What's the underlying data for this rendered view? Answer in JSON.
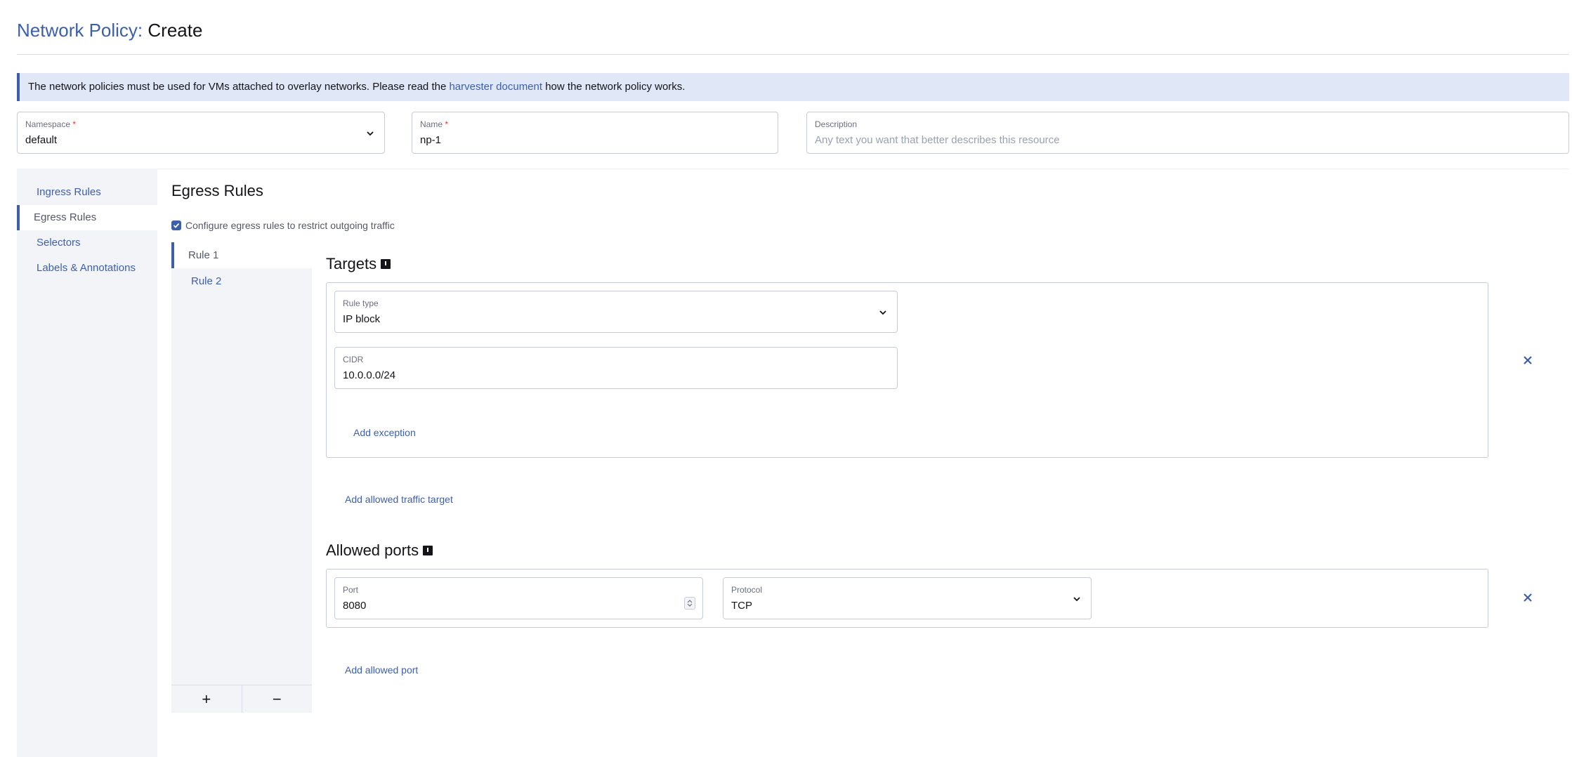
{
  "page": {
    "title_prefix": "Network Policy:",
    "title_mode": "Create"
  },
  "banner": {
    "text_before": "The network policies must be used for VMs attached to overlay networks. Please read the ",
    "link_text": "harvester document",
    "text_after": " how the network policy works."
  },
  "form": {
    "namespace": {
      "label": "Namespace",
      "required_mark": "*",
      "value": "default"
    },
    "name": {
      "label": "Name",
      "required_mark": "*",
      "value": "np-1"
    },
    "description": {
      "label": "Description",
      "placeholder": "Any text you want that better describes this resource"
    }
  },
  "sidebar": {
    "items": [
      {
        "label": "Ingress Rules",
        "active": false
      },
      {
        "label": "Egress Rules",
        "active": true
      },
      {
        "label": "Selectors",
        "active": false
      },
      {
        "label": "Labels & Annotations",
        "active": false
      }
    ]
  },
  "egress": {
    "title": "Egress Rules",
    "checkbox_label": "Configure egress rules to restrict outgoing traffic",
    "checkbox_checked": true,
    "rules": [
      {
        "label": "Rule 1",
        "active": true
      },
      {
        "label": "Rule 2",
        "active": false
      }
    ],
    "add_rule_symbol": "+",
    "remove_rule_symbol": "−",
    "targets": {
      "title": "Targets",
      "rule_type": {
        "label": "Rule type",
        "value": "IP block"
      },
      "cidr": {
        "label": "CIDR",
        "value": "10.0.0.0/24"
      },
      "add_exception_label": "Add exception",
      "add_target_label": "Add allowed traffic target"
    },
    "ports": {
      "title": "Allowed ports",
      "port": {
        "label": "Port",
        "value": "8080"
      },
      "protocol": {
        "label": "Protocol",
        "value": "TCP"
      },
      "add_port_label": "Add allowed port"
    }
  },
  "colors": {
    "accent": "#3d5fa8",
    "banner_bg": "#e0e8f7",
    "sidebar_bg": "#f3f4f8",
    "required": "#d13a3a"
  }
}
